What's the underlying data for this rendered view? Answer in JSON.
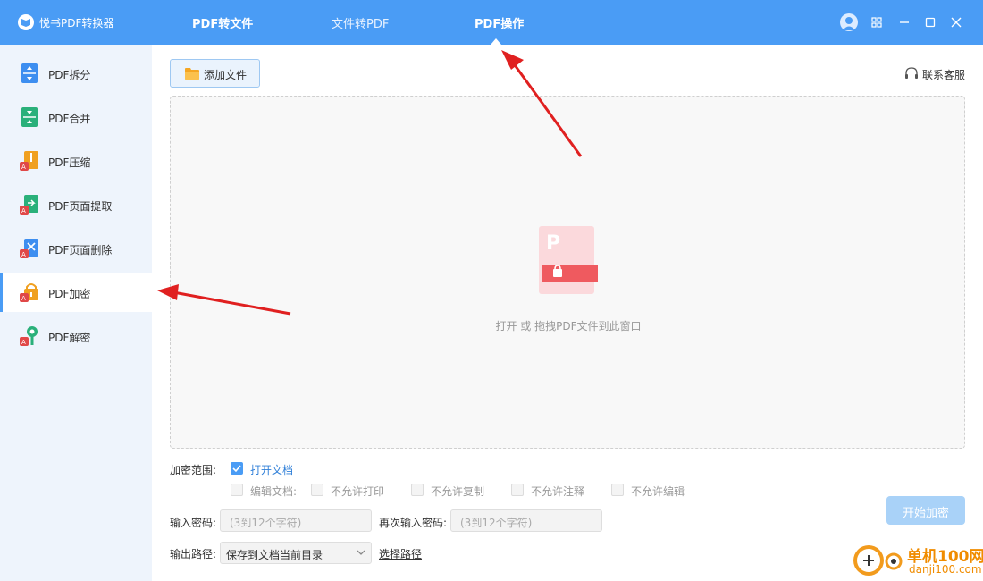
{
  "app": {
    "title": "悦书PDF转换器"
  },
  "nav": {
    "tabs": [
      {
        "label": "PDF转文件"
      },
      {
        "label": "文件转PDF"
      },
      {
        "label": "PDF操作"
      }
    ]
  },
  "sidebar": {
    "items": [
      {
        "label": "PDF拆分",
        "icon": "split-icon",
        "color": "#3d8ef0"
      },
      {
        "label": "PDF合并",
        "icon": "merge-icon",
        "color": "#2ab07a"
      },
      {
        "label": "PDF压缩",
        "icon": "compress-icon",
        "color": "#f0a020"
      },
      {
        "label": "PDF页面提取",
        "icon": "extract-icon",
        "color": "#2ab07a"
      },
      {
        "label": "PDF页面删除",
        "icon": "delete-icon",
        "color": "#3d8ef0"
      },
      {
        "label": "PDF加密",
        "icon": "lock-icon",
        "color": "#f0a020"
      },
      {
        "label": "PDF解密",
        "icon": "key-icon",
        "color": "#2ab07a"
      }
    ]
  },
  "toolbar": {
    "add_file": "添加文件",
    "support": "联系客服"
  },
  "dropzone": {
    "hint": "打开 或 拖拽PDF文件到此窗口"
  },
  "options": {
    "scope_label": "加密范围:",
    "open_doc": "打开文档",
    "edit_doc": "编辑文档:",
    "no_print": "不允许打印",
    "no_copy": "不允许复制",
    "no_annotate": "不允许注释",
    "no_edit": "不允许编辑",
    "password_label": "输入密码:",
    "password_placeholder": "(3到12个字符)",
    "confirm_label": "再次输入密码:",
    "confirm_placeholder": "(3到12个字符)",
    "output_label": "输出路径:",
    "output_value": "保存到文档当前目录",
    "choose_path": "选择路径"
  },
  "start_button": "开始加密",
  "watermark": {
    "text": "单机100网",
    "url": "danji100.com"
  },
  "colors": {
    "accent": "#4a9cf5",
    "annotation": "#e02020"
  }
}
